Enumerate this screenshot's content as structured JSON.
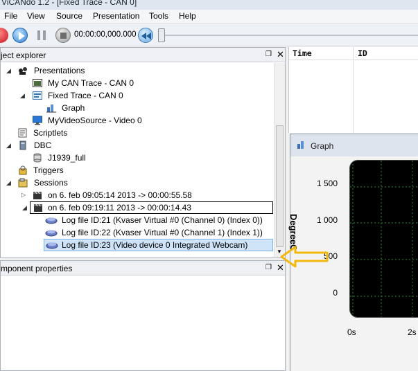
{
  "window": {
    "title": "ViCANdo 1.2 - [Fixed Trace - CAN 0]"
  },
  "menu": [
    "File",
    "View",
    "Source",
    "Presentation",
    "Tools",
    "Help"
  ],
  "toolbar": {
    "timecode": "00:00:00,000.000"
  },
  "project_explorer": {
    "title": "ject explorer",
    "tree": {
      "presentations": "Presentations",
      "my_can_trace": "My CAN Trace - CAN 0",
      "fixed_trace": "Fixed Trace - CAN 0",
      "graph": "Graph",
      "video_source": "MyVideoSource - Video 0",
      "scriptlets": "Scriptlets",
      "dbc": "DBC",
      "j1939": "J1939_full",
      "triggers": "Triggers",
      "sessions": "Sessions",
      "session1": "on 6. feb 09:05:14 2013 -> 00:00:55.58",
      "session2": "on 6. feb 09:19:11 2013 -> 00:00:14.43",
      "log21": "Log file ID:21 (Kvaser Virtual #0 (Channel 0) (Index 0))",
      "log22": "Log file ID:22 (Kvaser Virtual #0 (Channel 1) (Index 1))",
      "log23": "Log file ID:23 (Video device 0 Integrated Webcam)"
    }
  },
  "component_properties": {
    "title": "mponent properties"
  },
  "trace_table": {
    "columns": [
      "Time",
      "ID"
    ]
  },
  "graph_window": {
    "title": "Graph",
    "ylabel": "DegreeC",
    "yticks": [
      "1 500",
      "1 000",
      "500",
      "0"
    ],
    "xticks": [
      "0s",
      "2s"
    ],
    "plot_bg": "#000000",
    "grid_color": "#2e8b2e"
  },
  "colors": {
    "accent": "#f2b90c",
    "selection": "#cfe3f9"
  }
}
